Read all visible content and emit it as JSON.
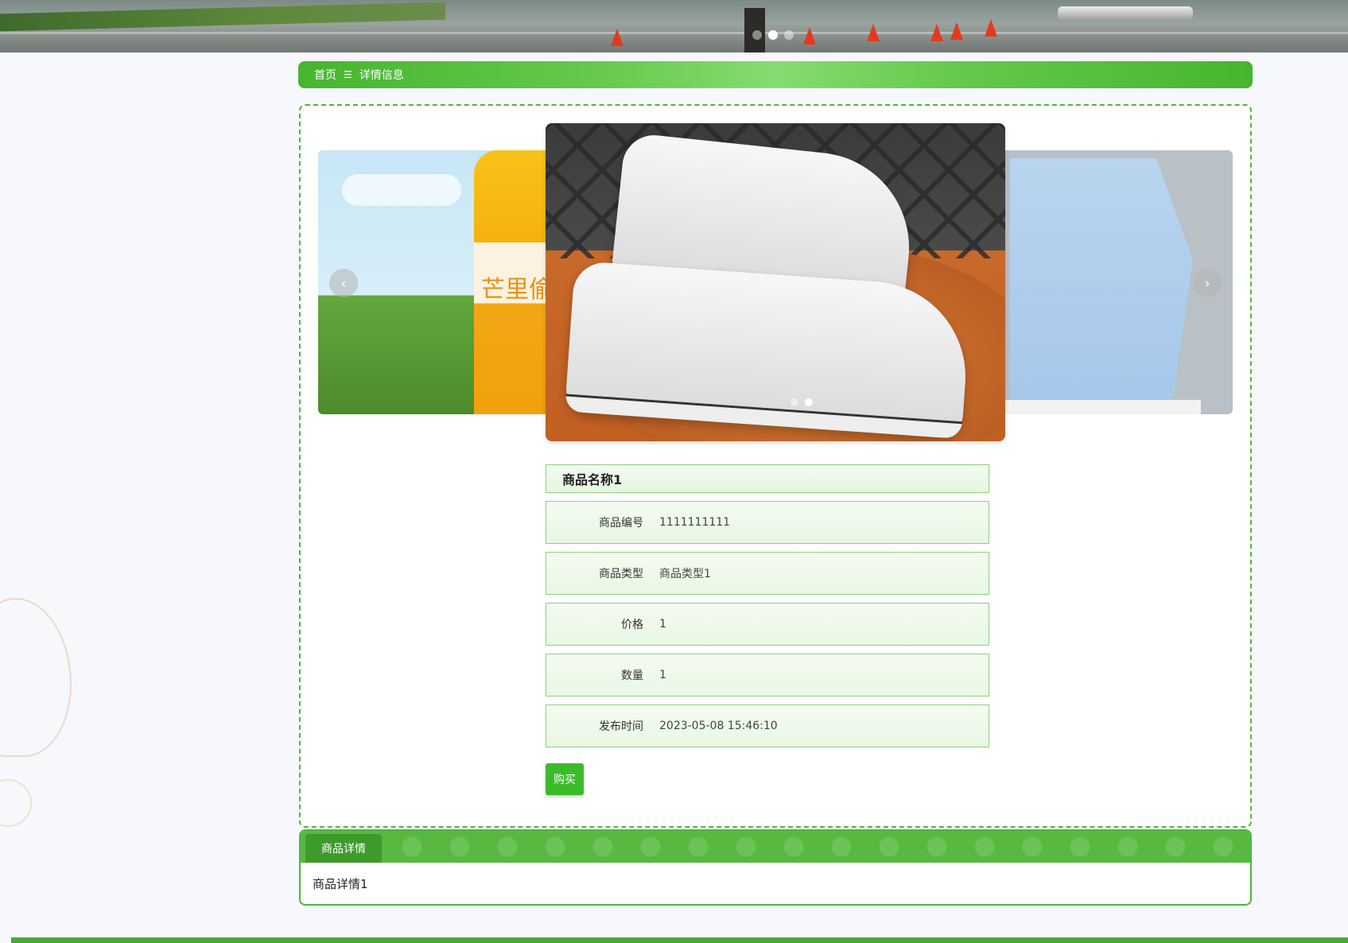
{
  "banner": {
    "dots": [
      {
        "active": false
      },
      {
        "active": true
      },
      {
        "active": false
      }
    ]
  },
  "breadcrumb": {
    "home": "首页",
    "separator": "☰",
    "current": "详情信息"
  },
  "carousel": {
    "left_image_text": "芒里偷",
    "prev_icon": "‹",
    "next_icon": "›"
  },
  "product": {
    "title": "商品名称1",
    "fields": [
      {
        "label": "商品编号",
        "value": "1111111111"
      },
      {
        "label": "商品类型",
        "value": "商品类型1"
      },
      {
        "label": "价格",
        "value": "1"
      },
      {
        "label": "数量",
        "value": "1"
      },
      {
        "label": "发布时间",
        "value": "2023-05-08 15:46:10"
      }
    ],
    "buy_label": "购买"
  },
  "detail": {
    "tab_label": "商品详情",
    "content": "商品详情1"
  },
  "colors": {
    "accent": "#4cb73a",
    "button": "#3cbb2a"
  }
}
